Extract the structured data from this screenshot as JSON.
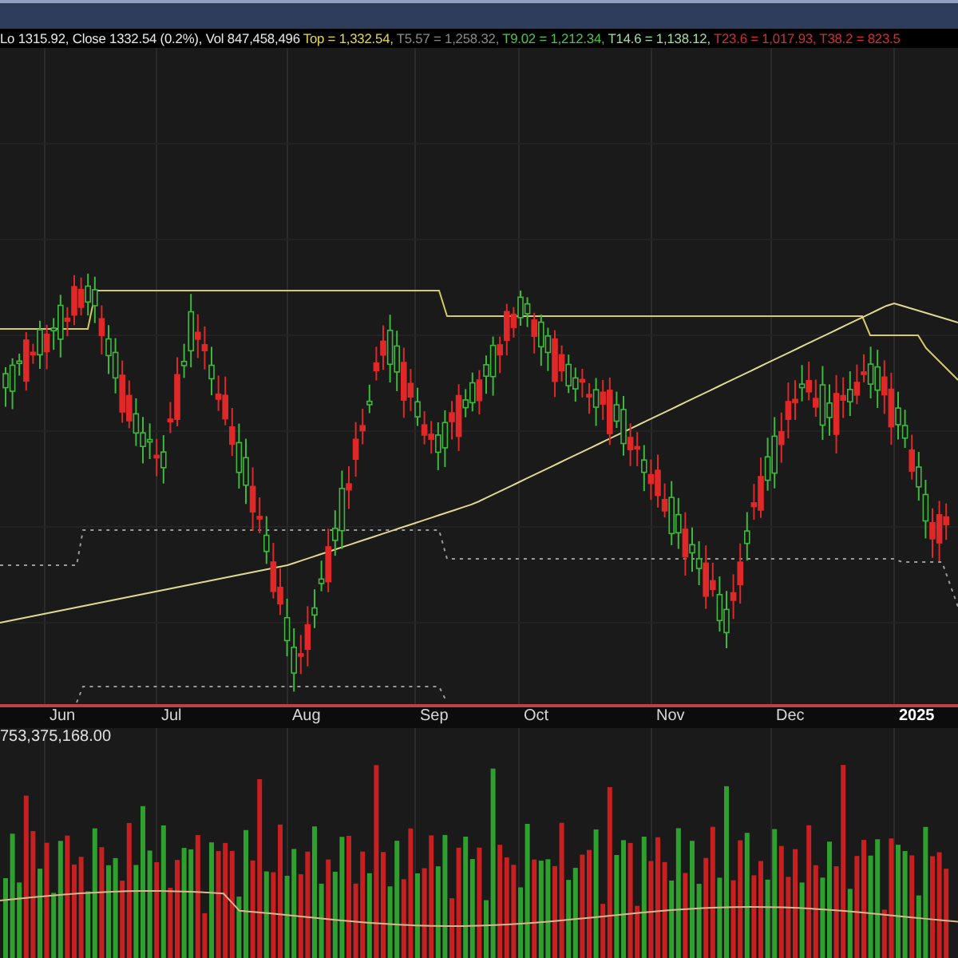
{
  "info_bar": [
    {
      "text": "Lo 1315.92, Close 1332.54 (0.2%), Vol 847,458,496",
      "color": "#e8e8e8"
    },
    {
      "text": "Top = 1,332.54,",
      "color": "#e8d84a"
    },
    {
      "text": "T5.57 = 1,258.32,",
      "color": "#8a8a8a"
    },
    {
      "text": "T9.02 = 1,212.34,",
      "color": "#4fc24f"
    },
    {
      "text": "T14.6 = 1,138.12,",
      "color": "#9fe09f"
    },
    {
      "text": "T23.6 = 1,017.93,",
      "color": "#d03030"
    },
    {
      "text": "T38.2 = 823.5",
      "color": "#d03030"
    }
  ],
  "x_axis": [
    {
      "label": "Jun",
      "kind": "month"
    },
    {
      "label": "Jul",
      "kind": "month"
    },
    {
      "label": "Aug",
      "kind": "month"
    },
    {
      "label": "Sep",
      "kind": "month"
    },
    {
      "label": "Oct",
      "kind": "month"
    },
    {
      "label": "Nov",
      "kind": "month"
    },
    {
      "label": "Dec",
      "kind": "month"
    },
    {
      "label": "2025",
      "kind": "year"
    }
  ],
  "volume_pane": {
    "label": "753,375,168.00"
  }
}
